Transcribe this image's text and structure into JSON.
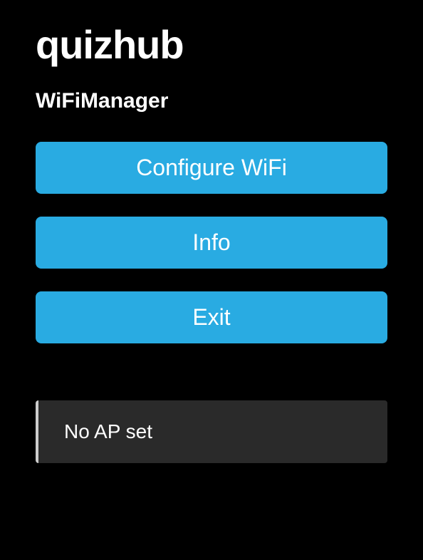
{
  "header": {
    "title": "quizhub",
    "subtitle": "WiFiManager"
  },
  "buttons": {
    "configure": "Configure WiFi",
    "info": "Info",
    "exit": "Exit"
  },
  "status": {
    "message": "No AP set"
  }
}
